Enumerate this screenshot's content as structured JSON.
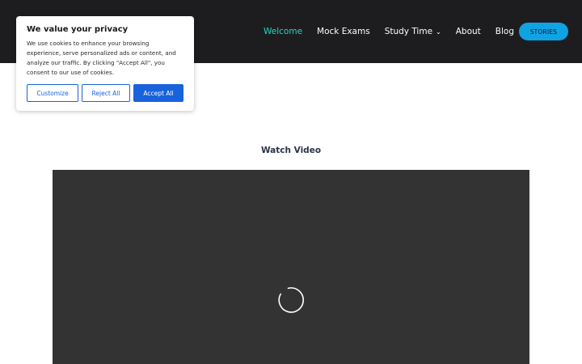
{
  "header": {
    "nav": [
      {
        "label": "Welcome",
        "active": true
      },
      {
        "label": "Mock Exams"
      },
      {
        "label": "Study Time",
        "has_dropdown": true
      },
      {
        "label": "About"
      },
      {
        "label": "Blog"
      }
    ],
    "cta_label": "STORIES"
  },
  "cookie_banner": {
    "title": "We value your privacy",
    "text": "We use cookies to enhance your browsing experience, serve personalized ads or content, and analyze our traffic. By clicking \"Accept All\", you consent to our use of cookies.",
    "customize_label": "Customize",
    "reject_label": "Reject All",
    "accept_label": "Accept All"
  },
  "main": {
    "section_title": "Watch Video",
    "video": {
      "state": "loading",
      "icon": "loading-spinner-icon"
    }
  },
  "colors": {
    "header_bg": "#1d1d1f",
    "active_nav": "#26d7c4",
    "cta_bg": "#0fa3e3",
    "cookie_primary": "#1863dc",
    "video_bg": "#333333"
  }
}
